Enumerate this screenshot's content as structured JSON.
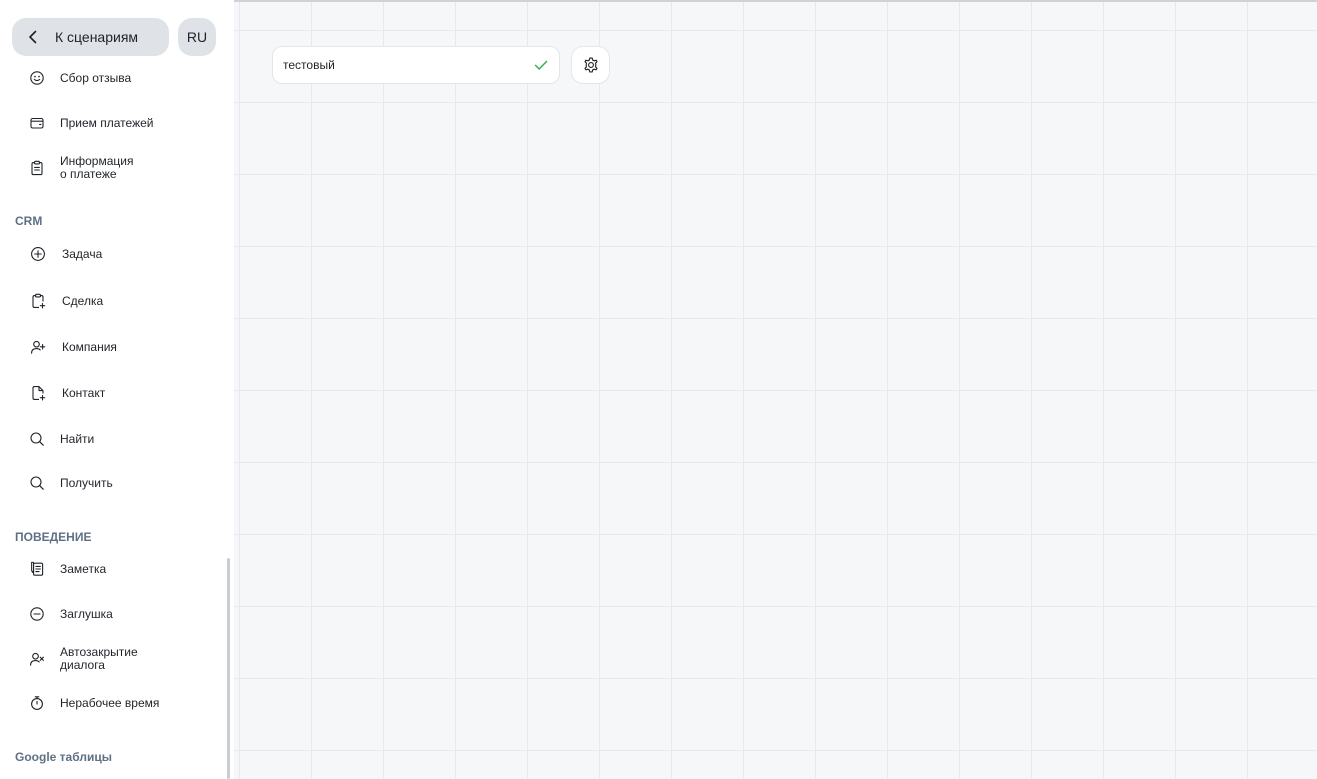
{
  "header": {
    "back_label": "К сценариям",
    "lang_label": "RU"
  },
  "sidebar": {
    "items_top": [
      {
        "label": "Сбор отзыва",
        "icon": "smile-icon"
      },
      {
        "label": "Прием платежей",
        "icon": "wallet-icon"
      },
      {
        "label": "Информация\nо платеже",
        "icon": "clipboard-icon"
      }
    ],
    "crm": {
      "title": "CRM",
      "items": [
        {
          "label": "Задача",
          "icon": "plus-circle-icon"
        },
        {
          "label": "Сделка",
          "icon": "clipboard-plus-icon"
        },
        {
          "label": "Компания",
          "icon": "user-plus-icon"
        },
        {
          "label": "Контакт",
          "icon": "file-plus-icon"
        },
        {
          "label": "Найти",
          "icon": "search-icon"
        },
        {
          "label": "Получить",
          "icon": "search-icon"
        }
      ]
    },
    "behavior": {
      "title": "ПОВЕДЕНИЕ",
      "items": [
        {
          "label": "Заметка",
          "icon": "note-icon"
        },
        {
          "label": "Заглушка",
          "icon": "minus-circle-icon"
        },
        {
          "label": "Автозакрытие\nдиалога",
          "icon": "user-x-icon"
        },
        {
          "label": "Нерабочее время",
          "icon": "stopwatch-icon"
        }
      ]
    },
    "google": {
      "title": "Google таблицы"
    }
  },
  "canvas": {
    "scenario_name": "тестовый",
    "confirm_icon": "check-icon",
    "settings_icon": "gear-icon"
  },
  "colors": {
    "sidebar_bg": "#ffffff",
    "button_bg": "#dfe3e8",
    "section_title": "#5e7184",
    "canvas_bg": "#f6f7f9",
    "grid_line": "#e7e9ec",
    "check": "#2fb34e"
  }
}
